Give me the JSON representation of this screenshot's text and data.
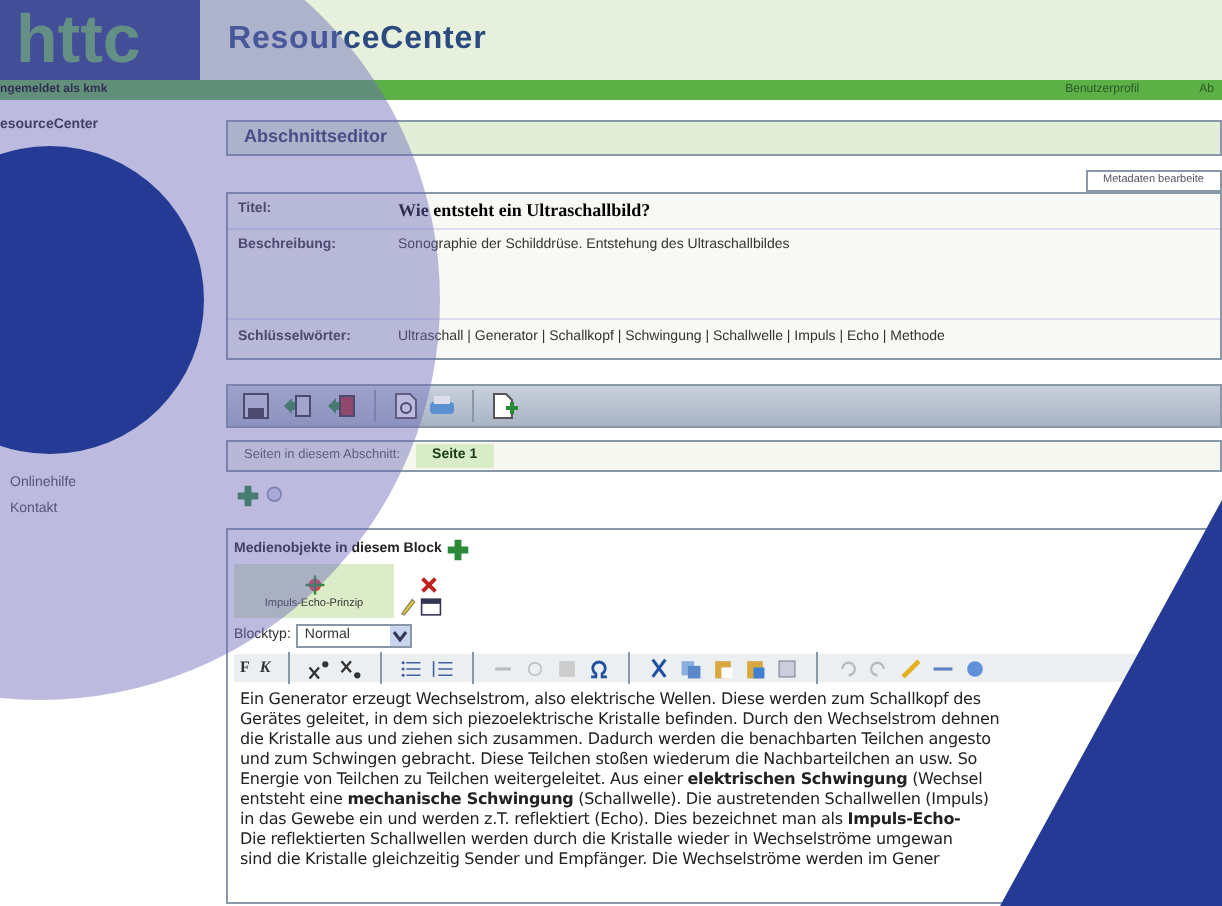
{
  "header": {
    "logo": "httc",
    "title": "ResourceCenter"
  },
  "user_bar": {
    "user": "ngemeldet als kmk",
    "links": [
      "Benutzerprofil",
      "Ab"
    ]
  },
  "sidebar": {
    "top_items": [
      "esourceCenter"
    ],
    "bottom_items": [
      "Onlinehilfe",
      "Kontakt"
    ]
  },
  "editor": {
    "title": "Abschnittseditor",
    "metadata_button": "Metadaten bearbeite",
    "fields": [
      {
        "kind": "title",
        "label": "Titel:",
        "value": "Wie entsteht ein Ultraschallbild?"
      },
      {
        "kind": "text",
        "label": "Beschreibung:",
        "value": "Sonographie der Schilddrüse. Entstehung des Ultraschallbildes"
      },
      {
        "kind": "keywords",
        "label": "Schlüsselwörter:",
        "value": "Ultraschall | Generator | Schallkopf | Schwingung | Schallwelle | Impuls | Echo | Methode"
      }
    ],
    "pages": {
      "label": "Seiten in diesem Abschnitt:",
      "tabs": [
        {
          "label": "Seite 1",
          "selected": true
        }
      ]
    },
    "media": {
      "title": "Medienobjekte in diesem Block",
      "items": [
        {
          "label": "Impuls-Echo-Prinzip"
        }
      ]
    },
    "block_type": {
      "label": "Blocktyp:",
      "value": "Normal"
    },
    "format_buttons": [
      "F",
      "K"
    ],
    "text_lines": [
      "Ein Generator erzeugt Wechselstrom, also elektrische Wellen. Diese werden zum Schallkopf des",
      "Gerätes geleitet, in dem sich piezoelektrische Kristalle befinden. Durch den Wechselstrom dehnen",
      "die Kristalle aus und ziehen sich zusammen. Dadurch werden die benachbarten Teilchen angesto",
      "und zum Schwingen gebracht. Diese Teilchen stoßen wiederum die Nachbarteilchen an usw. So",
      "Energie von Teilchen zu Teilchen weitergeleitet. Aus einer **elektrischen Schwingung** (Wechsel",
      "entsteht eine **mechanische Schwingung** (Schallwelle). Die austretenden Schallwellen (Impuls)",
      "in das Gewebe ein und werden z.T. reflektiert (Echo). Dies bezeichnet man als **Impuls-Echo-**",
      "Die reflektierten Schallwellen werden durch die Kristalle wieder in Wechselströme umgewan",
      "sind die Kristalle gleichzeitig Sender und Empfänger. Die Wechselströme werden im Gener"
    ]
  }
}
